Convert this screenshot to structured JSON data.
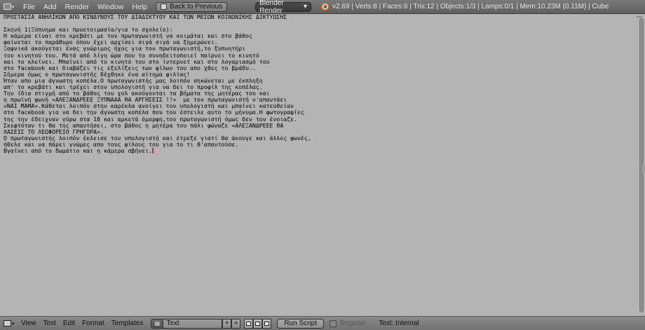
{
  "top_header": {
    "menus": [
      "File",
      "Add",
      "Render",
      "Window",
      "Help"
    ],
    "back_button": "Back to Previous",
    "render_engine": "Blender Render",
    "stats": "v2.69 | Verts:8 | Faces:6 | Tris:12 | Objects:1/3 | Lamps:0/1 | Mem:10.23M (0.11M) | Cube"
  },
  "text_editor": {
    "lines": [
      "ΠΡΟΣΤΑΣΙΑ ΑΝΗΛΙΚΩΝ ΑΠΟ ΚΙΝΔΥΝΟΥΣ ΤΟΥ ΔΙΑΔΙΚΤΥΟΥ ΚΑΙ ΤΩΝ ΜΕΣΩΝ ΚΟΙΝΩΝΙΚΗΣ ΔΙΚΤΥΩΣΗΣ",
      "",
      "Σκηνή 1(Ξύπνημα και προετοιμασία/για το σχολείο):",
      "Η κάμερα είναι στο κρεβάτι με τον πρωταγωνιστή να κοιμάται και στο βάθος",
      "φαίνεται το παράθυρο όπου έχει αρχίσει σιγά σιγά να ξημερώνει.",
      "Ξαφνικά ακούγεται ένας γνώριμος ήχος για τον πρωταγωνιστή,το ξυπνητήρι",
      "του κινητού του. Μετά από λίγη ώρα που το συνηδειτοποιεί παίρνει το κινητό",
      "και το κλείνει. Μπαίνει από το κινητό του στο ίντερνετ και στο λογαριασμό του",
      "στο facebook και διαβάζει τις εξελίξεις των φίλων του απο χθες το βράδυ..",
      "Σήμερα όμως ο πρωταγωνιστής δέχθηκε ένα αίτημα φιλίας!",
      "Ήταν απο μια άγνωστη κοπέλα.Ο πρωταγωνιστής μας λοιπόν σηκώνεται με έκπληξη",
      "απ' το κρεβάτι και τρέχει στον υπολογιστή για να δει το προφίλ της κοπέλας.",
      "Την ίδια στιγμή από το βάθος του χολ ακούγονται τα βήματα της μητέρας του και",
      "η πρωϊνή φωνή «ΑΛΕΞΑΝΔΡΕΕΕ ΞΥΠΝΑΑΑ ΘΑ ΑΡΓΗΣΕΙΣ !!»  με τον πρωταγωνιστή ν'απαντάει",
      "«ΝΑΙ ΜΑΜΑ».Κάθεται λοιπόν στην καρέκλα ανοίγει τον υπολογιστή και μπαίνει κατευθείαν",
      "στο facebook για να δει την άγνωστη κοπέλα που του έστειλε αυτο το μήνυμα.Η φωτογραφίες",
      "της την έδειχναν γύρω στα 18 και αρκετά όμορφη,τον πρωταγωνιστή όμως δεν τον ένοιαζε.",
      "Σκεφτόταν τι θα της απαντήσει, στο βάθος η μητέρα του πάλι φώναζε «ΑΛΕΞΑΝΔΡΕΕΕ ΘΑ",
      "ΧΑΣΕΙΣ ΤΟ ΛΕΩΦΟΡΕΙΟ ΓΡΗΓΟΡΑ».",
      "Ο πρωταγωνιστής λοιπόν έκλεισε τον υπολογιστή και έτρεξε γιατί θα άκουγε και άλλες φωνές,",
      "ήθελε και να πάρει γνώμες απο τους φίλους του για το τι θ'απαντούσε.",
      "Βγαίνει από το δωμάτιο και η κάμερα σβήνει."
    ]
  },
  "bottom_header": {
    "menus": [
      "View",
      "Text",
      "Edit",
      "Format",
      "Templates"
    ],
    "text_block_name": "Text",
    "run_script": "Run Script",
    "register": "Register",
    "status": "Text: Internal"
  },
  "icons": {
    "add": "+",
    "close": "×"
  }
}
